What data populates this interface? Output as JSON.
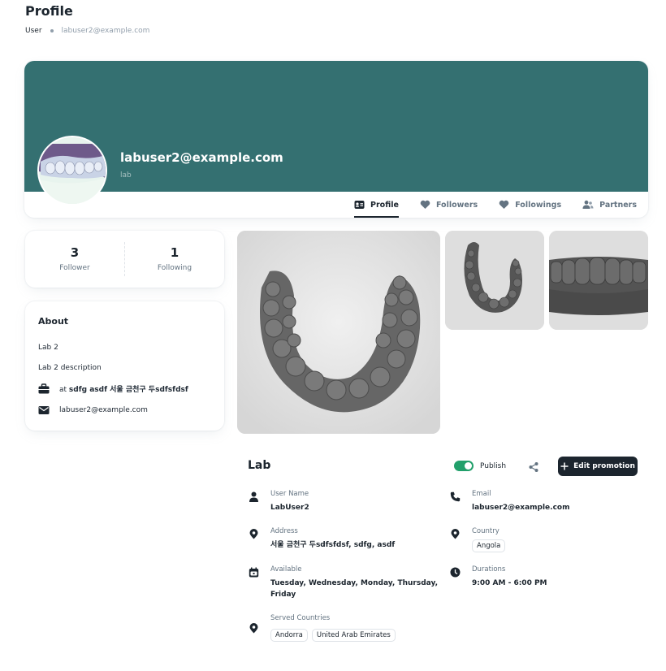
{
  "header": {
    "title": "Profile",
    "breadcrumb": [
      "User",
      "labuser2@example.com"
    ]
  },
  "cover": {
    "name": "labuser2@example.com",
    "role": "lab",
    "bg_color": "#347071"
  },
  "tabs": [
    {
      "label": "Profile",
      "icon": "profile-card-icon",
      "active": true
    },
    {
      "label": "Followers",
      "icon": "heart-icon",
      "active": false
    },
    {
      "label": "Followings",
      "icon": "heart-icon",
      "active": false
    },
    {
      "label": "Partners",
      "icon": "users-icon",
      "active": false
    }
  ],
  "stats": {
    "follower": {
      "value": "3",
      "label": "Follower"
    },
    "following": {
      "value": "1",
      "label": "Following"
    }
  },
  "about": {
    "title": "About",
    "name": "Lab 2",
    "description": "Lab 2 description",
    "company_prefix": "at",
    "company": "sdfg asdf 서울 금천구 두sdfsfdsf",
    "email": "labuser2@example.com"
  },
  "lab": {
    "title": "Lab",
    "publish_label": "Publish",
    "publish_on": true,
    "edit_label": "Edit promotion",
    "fields": {
      "user_name": {
        "label": "User Name",
        "value": "LabUser2"
      },
      "email": {
        "label": "Email",
        "value": "labuser2@example.com"
      },
      "address": {
        "label": "Address",
        "value": "서울 금천구 두sdfsfdsf, sdfg, asdf"
      },
      "country": {
        "label": "Country",
        "chips": [
          "Angola"
        ]
      },
      "available": {
        "label": "Available",
        "value_line1": "Tuesday, Wednesday, Monday, Thursday,",
        "value_line2": "Friday"
      },
      "durations": {
        "label": "Durations",
        "value": "9:00 AM - 6:00 PM"
      },
      "served_countries": {
        "label": "Served Countries",
        "chips": [
          "Andorra",
          "United Arab Emirates"
        ]
      }
    }
  },
  "colors": {
    "accent_dark": "#1c252e",
    "toggle_on": "#22a06b"
  }
}
